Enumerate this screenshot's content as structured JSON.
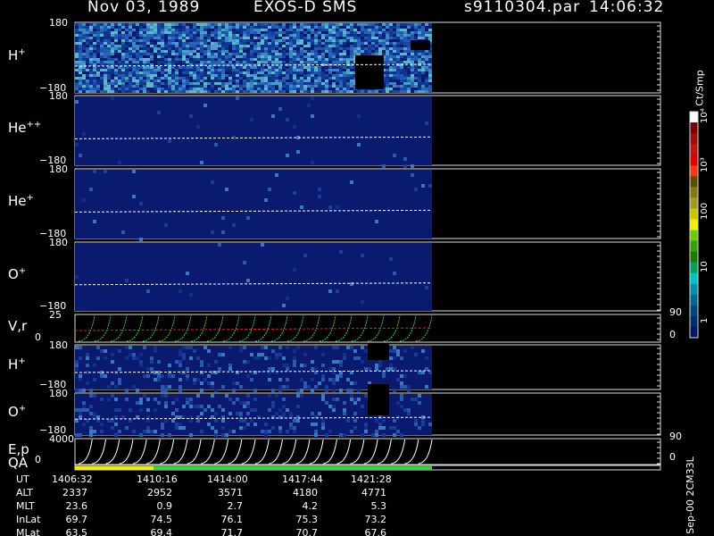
{
  "header": {
    "date": "Nov 03, 1989",
    "instrument": "EXOS-D SMS",
    "file": "s9110304.par",
    "time": "14:06:32"
  },
  "colorbar": {
    "unit": "Ct/Smp",
    "ticks": [
      "10⁴",
      "10³",
      "100",
      "10",
      "1"
    ],
    "colors": [
      "#ffffff",
      "#7a0000",
      "#9e0d0d",
      "#c01414",
      "#e00000",
      "#f23a0a",
      "#5c5000",
      "#827a10",
      "#a09a20",
      "#c8c800",
      "#f0f000",
      "#6ccc00",
      "#38a000",
      "#1e7a00",
      "#00a060",
      "#00c0c8",
      "#0090b0",
      "#006890",
      "#004878",
      "#002c6c",
      "#00186a"
    ]
  },
  "panels": [
    {
      "id": "h-plus-top",
      "label": "H",
      "sup": "+",
      "ymax": "180",
      "ymin": "−180",
      "type": "spectrogram",
      "intensity": "high",
      "gap": [
        [
          398,
          430,
          62,
          100
        ],
        [
          460,
          482,
          45,
          56
        ]
      ]
    },
    {
      "id": "he-plus-plus",
      "label": "He",
      "sup": "++",
      "ymax": "180",
      "ymin": "−180",
      "type": "spectrogram",
      "intensity": "low"
    },
    {
      "id": "he-plus",
      "label": "He",
      "sup": "+",
      "ymax": "180",
      "ymin": "−180",
      "type": "spectrogram",
      "intensity": "low"
    },
    {
      "id": "o-plus-top",
      "label": "O",
      "sup": "+",
      "ymax": "180",
      "ymin": "−180",
      "type": "spectrogram",
      "intensity": "low"
    },
    {
      "id": "vr",
      "label": "V,r",
      "sup": "",
      "ymax": "25",
      "ymin": "0",
      "rmax": "90",
      "rmin": "0",
      "type": "line"
    },
    {
      "id": "h-plus-bottom",
      "label": "H",
      "sup": "+",
      "ymax": "180",
      "ymin": "−180",
      "type": "spectrogram",
      "intensity": "medium",
      "gap": [
        [
          412,
          436,
          385,
          403
        ]
      ]
    },
    {
      "id": "o-plus-bottom",
      "label": "O",
      "sup": "+",
      "ymax": "180",
      "ymin": "−180",
      "type": "spectrogram",
      "intensity": "medium",
      "gap": [
        [
          412,
          436,
          430,
          465
        ]
      ]
    },
    {
      "id": "ep",
      "label": "E,p",
      "sup": "",
      "ymax": "4000",
      "ymin": "0",
      "rmax": "90",
      "rmin": "0",
      "type": "line"
    }
  ],
  "qa": {
    "label": "QA",
    "segments": [
      {
        "from": "1406:32",
        "to": "1410:00",
        "color": "#f0f000"
      },
      {
        "from": "1410:00",
        "to": "1424:30",
        "color": "#38d838"
      }
    ]
  },
  "ephemeris": {
    "rows": [
      {
        "name": "UT",
        "values": [
          "1406:32",
          "1410:16",
          "1414:00",
          "1417:44",
          "1421:28"
        ]
      },
      {
        "name": "ALT",
        "values": [
          "2337",
          "2952",
          "3571",
          "4180",
          "4771"
        ]
      },
      {
        "name": "MLT",
        "values": [
          "23.6",
          "0.9",
          "2.7",
          "4.2",
          "5.3"
        ]
      },
      {
        "name": "InLat",
        "values": [
          "69.7",
          "74.5",
          "76.1",
          "75.3",
          "73.2"
        ]
      },
      {
        "name": "MLat",
        "values": [
          "63.5",
          "69.4",
          "71.7",
          "70.7",
          "67.6"
        ]
      }
    ]
  },
  "footer": {
    "version": "Sep-00 2CM33L"
  },
  "chart_data": {
    "type": "heatmap",
    "title": "Nov 03, 1989   EXOS-D SMS",
    "x": [
      "1406:32",
      "1410:16",
      "1414:00",
      "1417:44",
      "1421:28"
    ],
    "xlabel": "UT",
    "series": [
      {
        "name": "H+",
        "ylim": [
          -180,
          180
        ]
      },
      {
        "name": "He++",
        "ylim": [
          -180,
          180
        ]
      },
      {
        "name": "He+",
        "ylim": [
          -180,
          180
        ]
      },
      {
        "name": "O+",
        "ylim": [
          -180,
          180
        ]
      },
      {
        "name": "V,r",
        "ylim": [
          0,
          25
        ],
        "ylim_right": [
          0,
          90
        ]
      },
      {
        "name": "H+",
        "ylim": [
          -180,
          180
        ]
      },
      {
        "name": "O+",
        "ylim": [
          -180,
          180
        ]
      },
      {
        "name": "E,p",
        "ylim": [
          0,
          4000
        ],
        "ylim_right": [
          0,
          90
        ]
      }
    ],
    "colorscale": {
      "unit": "Ct/Smp",
      "range": [
        1,
        10000
      ],
      "log": true
    }
  }
}
